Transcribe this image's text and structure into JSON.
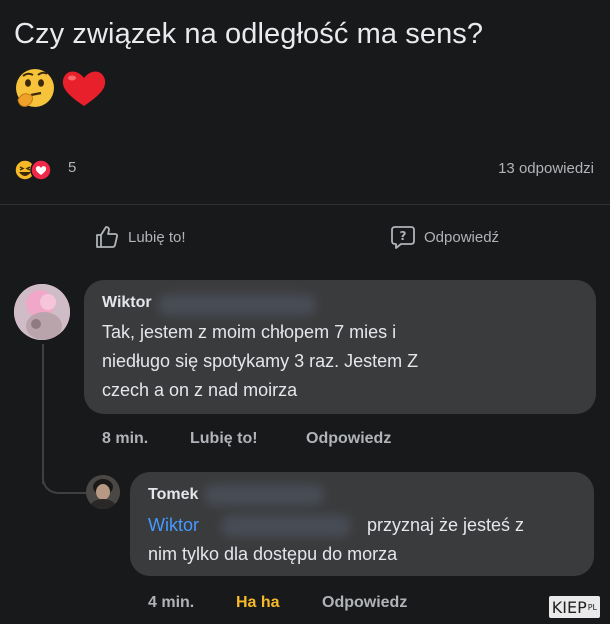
{
  "post": {
    "question": "Czy związek na odległość ma sens?",
    "reaction_count": "5",
    "replies_count": "13 odpowiedzi",
    "like_label": "Lubię to!",
    "reply_label": "Odpowiedź"
  },
  "comments": [
    {
      "author": "Wiktor",
      "text_lines": [
        "Tak, jestem z moim chłopem 7 mies i",
        "niedługo się spotykamy 3 raz. Jestem Z",
        "czech a on z nad moirza"
      ],
      "time": "8 min.",
      "like": "Lubię to!",
      "reply": "Odpowiedz"
    },
    {
      "author": "Tomek",
      "mention": "Wiktor",
      "text_after_mention": "przyznaj że jesteś z",
      "text_line2": "nim tylko dla dostępu do morza",
      "time": "4 min.",
      "reaction": "Ha ha",
      "reply": "Odpowiedz"
    }
  ],
  "watermark": {
    "text": "KIEP",
    "suffix": "PL"
  },
  "colors": {
    "background": "#18191a",
    "bubble": "#3a3b3c",
    "mention": "#4599ff",
    "haha": "#f7b928",
    "heart": "#f02849"
  },
  "icons": [
    "thinking-face-emoji",
    "heart-emoji",
    "haha-reaction-icon",
    "love-reaction-icon",
    "thumbs-up-icon",
    "question-bubble-icon"
  ]
}
